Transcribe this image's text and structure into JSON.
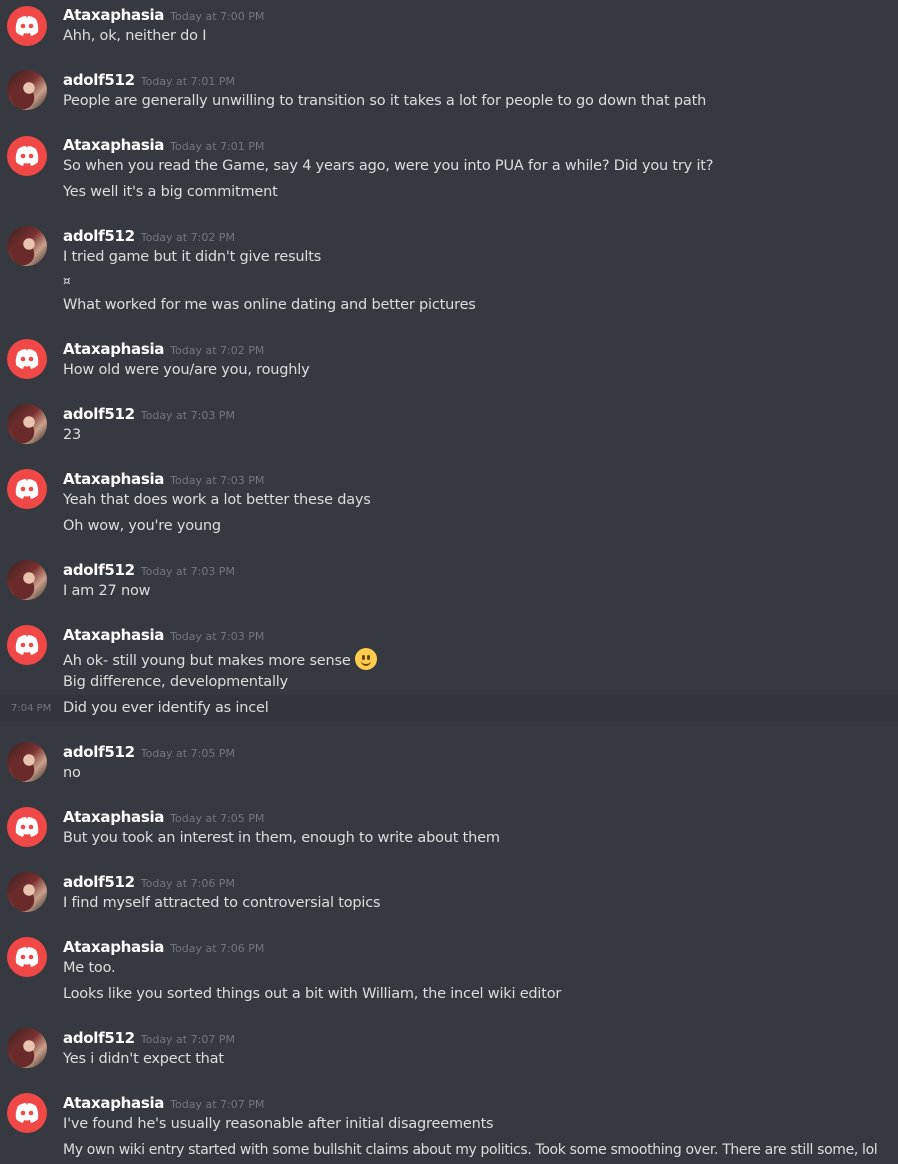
{
  "colors": {
    "background": "#36393f",
    "username": "#ffffff",
    "timestamp": "#72767d",
    "text": "#dcddde",
    "discord_avatar": "#f04747"
  },
  "messages": [
    {
      "user": "Ataxaphasia",
      "time": "Today at 7:00 PM",
      "lines": [
        "Ahh, ok, neither do I"
      ]
    },
    {
      "user": "adolf512",
      "time": "Today at 7:01 PM",
      "lines": [
        "People are generally unwilling to transition so it takes a lot for people to go down that path"
      ]
    },
    {
      "user": "Ataxaphasia",
      "time": "Today at 7:01 PM",
      "lines": [
        "So when you read the Game, say 4 years ago, were you into PUA for a while? Did you try it?",
        "Yes well it's a big commitment"
      ]
    },
    {
      "user": "adolf512",
      "time": "Today at 7:02 PM",
      "lines": [
        "I tried game but it didn't give results",
        "¤",
        "What worked for me was online dating and better pictures"
      ]
    },
    {
      "user": "Ataxaphasia",
      "time": "Today at 7:02 PM",
      "lines": [
        "How old were you/are you, roughly"
      ]
    },
    {
      "user": "adolf512",
      "time": "Today at 7:03 PM",
      "lines": [
        "23"
      ]
    },
    {
      "user": "Ataxaphasia",
      "time": "Today at 7:03 PM",
      "lines": [
        "Yeah that does work a lot better these days",
        "Oh wow, you're young"
      ]
    },
    {
      "user": "adolf512",
      "time": "Today at 7:03 PM",
      "lines": [
        "I am 27 now"
      ]
    },
    {
      "user": "Ataxaphasia",
      "time": "Today at 7:03 PM",
      "lines": [
        "Ah ok- still young but makes more sense",
        "Big difference, developmentally",
        "Did you ever identify as incel"
      ]
    },
    {
      "user": "adolf512",
      "time": "Today at 7:05 PM",
      "lines": [
        "no"
      ]
    },
    {
      "user": "Ataxaphasia",
      "time": "Today at 7:05 PM",
      "lines": [
        "But you took an interest in them, enough to write about them"
      ]
    },
    {
      "user": "adolf512",
      "time": "Today at 7:06 PM",
      "lines": [
        "I find myself attracted to controversial topics"
      ]
    },
    {
      "user": "Ataxaphasia",
      "time": "Today at 7:06 PM",
      "lines": [
        "Me too.",
        "Looks like you sorted things out a bit with William, the incel wiki editor"
      ]
    },
    {
      "user": "adolf512",
      "time": "Today at 7:07 PM",
      "lines": [
        "Yes i didn't expect that"
      ]
    },
    {
      "user": "Ataxaphasia",
      "time": "Today at 7:07 PM",
      "lines": [
        "I've found he's usually reasonable after initial disagreements",
        "My own wiki entry started with some bullshit claims about my politics. Took some smoothing over. There are still some, lol"
      ]
    }
  ],
  "hover_time": "7:04 PM",
  "emoji": "slightly-smiling-face-icon"
}
